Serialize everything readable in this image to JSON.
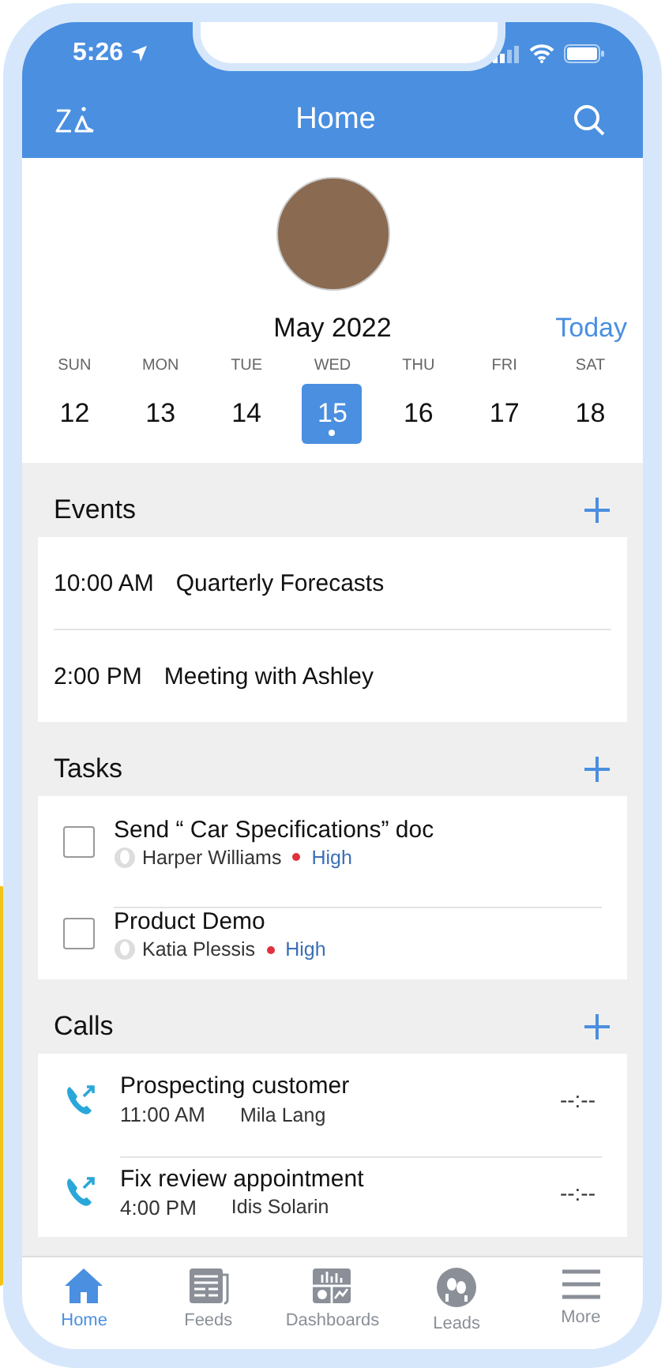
{
  "status_bar": {
    "time": "5:26"
  },
  "header": {
    "title": "Home"
  },
  "calendar": {
    "month": "May 2022",
    "today_label": "Today",
    "days": [
      {
        "weekday": "SUN",
        "date": "12",
        "selected": false,
        "has_events": false
      },
      {
        "weekday": "MON",
        "date": "13",
        "selected": false,
        "has_events": false
      },
      {
        "weekday": "TUE",
        "date": "14",
        "selected": false,
        "has_events": false
      },
      {
        "weekday": "WED",
        "date": "15",
        "selected": true,
        "has_events": true
      },
      {
        "weekday": "THU",
        "date": "16",
        "selected": false,
        "has_events": false
      },
      {
        "weekday": "FRI",
        "date": "17",
        "selected": false,
        "has_events": false
      },
      {
        "weekday": "SAT",
        "date": "18",
        "selected": false,
        "has_events": false
      }
    ]
  },
  "sections": [
    {
      "kind": "events",
      "title": "Events",
      "items": [
        {
          "time": "10:00 AM",
          "title": "Quarterly Forecasts"
        },
        {
          "time": "2:00 PM",
          "title": "Meeting with Ashley"
        }
      ]
    },
    {
      "kind": "tasks",
      "title": "Tasks",
      "items": [
        {
          "title": "Send “ Car Specifications” doc",
          "owner": "Harper Williams",
          "priority": "High",
          "color": "#e0323c",
          "checked": false
        },
        {
          "title": "Product Demo",
          "owner": "Katia Plessis",
          "priority": "High",
          "color": "#e0323c",
          "checked": false
        }
      ]
    },
    {
      "kind": "calls",
      "title": "Calls",
      "items": [
        {
          "title": "Prospecting customer",
          "time": "11:00 AM",
          "contact": "Mila Lang",
          "duration": "--:--"
        },
        {
          "title": "Fix review appointment",
          "time": "4:00 PM",
          "contact": "Idis Solarin",
          "duration": "--:--"
        }
      ]
    }
  ],
  "tab_bar": [
    {
      "kind": "home",
      "label": "Home",
      "selected": true
    },
    {
      "kind": "feeds",
      "label": "Feeds",
      "selected": false
    },
    {
      "kind": "dashboards",
      "label": "Dashboards",
      "selected": false
    },
    {
      "kind": "leads",
      "label": "Leads",
      "selected": false
    },
    {
      "kind": "more",
      "label": "More",
      "selected": false
    }
  ]
}
